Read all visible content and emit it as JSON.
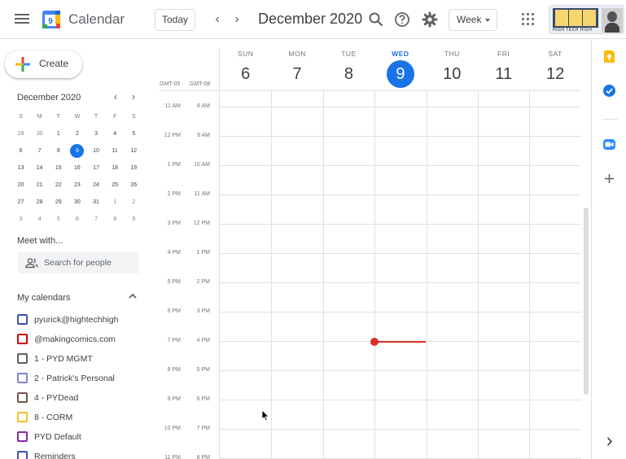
{
  "header": {
    "app_title": "Calendar",
    "logo_day": "9",
    "today_label": "Today",
    "prev_symbol": "‹",
    "next_symbol": "›",
    "date_title": "December 2020",
    "view_label": "Week",
    "org_logo_tag": "HIGH TECH HIGH",
    "icons": [
      "menu-icon",
      "search-icon",
      "help-icon",
      "settings-icon",
      "apps-icon",
      "organization-logo"
    ]
  },
  "sidebar": {
    "create_label": "Create",
    "mini_calendar": {
      "title": "December 2020",
      "prev_symbol": "‹",
      "next_symbol": "›",
      "weekdays": [
        "S",
        "M",
        "T",
        "W",
        "T",
        "F",
        "S"
      ],
      "weeks": [
        [
          "29",
          "30",
          "1",
          "2",
          "3",
          "4",
          "5"
        ],
        [
          "6",
          "7",
          "8",
          "9",
          "10",
          "11",
          "12"
        ],
        [
          "13",
          "14",
          "15",
          "16",
          "17",
          "18",
          "19"
        ],
        [
          "20",
          "21",
          "22",
          "23",
          "24",
          "25",
          "26"
        ],
        [
          "27",
          "28",
          "29",
          "30",
          "31",
          "1",
          "2"
        ],
        [
          "3",
          "4",
          "5",
          "6",
          "7",
          "8",
          "9"
        ]
      ],
      "selected_day": "9"
    },
    "meet_with_title": "Meet with...",
    "search_people_placeholder": "Search for people",
    "my_calendars_title": "My calendars",
    "calendars": [
      {
        "name": "pyurick@hightechhigh",
        "color": "#3f51b5"
      },
      {
        "name": "@makingcomics.com",
        "color": "#d50000"
      },
      {
        "name": "1 - PYD MGMT",
        "color": "#616161"
      },
      {
        "name": "2 - Patrick's Personal",
        "color": "#7986cb"
      },
      {
        "name": "4 - PYDead",
        "color": "#795548"
      },
      {
        "name": "8 - CORM",
        "color": "#f6bf26"
      },
      {
        "name": "PYD Default",
        "color": "#8e24aa"
      },
      {
        "name": "Reminders",
        "color": "#3f51b5"
      }
    ]
  },
  "week_view": {
    "timezones": [
      "GMT-05",
      "GMT-08"
    ],
    "days": [
      {
        "name": "SUN",
        "num": "6"
      },
      {
        "name": "MON",
        "num": "7"
      },
      {
        "name": "TUE",
        "num": "8"
      },
      {
        "name": "WED",
        "num": "9"
      },
      {
        "name": "THU",
        "num": "10"
      },
      {
        "name": "FRI",
        "num": "11"
      },
      {
        "name": "SAT",
        "num": "12"
      }
    ],
    "today_day": "WED",
    "times_primary": [
      "11 AM",
      "12 PM",
      "1 PM",
      "2 PM",
      "3 PM",
      "4 PM",
      "5 PM",
      "6 PM",
      "7 PM",
      "8 PM",
      "9 PM",
      "10 PM",
      "11 PM"
    ],
    "times_secondary": [
      "8 AM",
      "9 AM",
      "10 AM",
      "11 AM",
      "12 PM",
      "1 PM",
      "2 PM",
      "3 PM",
      "4 PM",
      "5 PM",
      "6 PM",
      "7 PM",
      "8 PM"
    ]
  },
  "side_panel": {
    "icons": [
      "keep-icon",
      "tasks-icon",
      "zoom-icon",
      "add-addon-icon",
      "expand-panel-icon"
    ]
  },
  "colors": {
    "accent": "#1a73e8",
    "now_line": "#d93025",
    "gridline": "#e0e0e0"
  }
}
